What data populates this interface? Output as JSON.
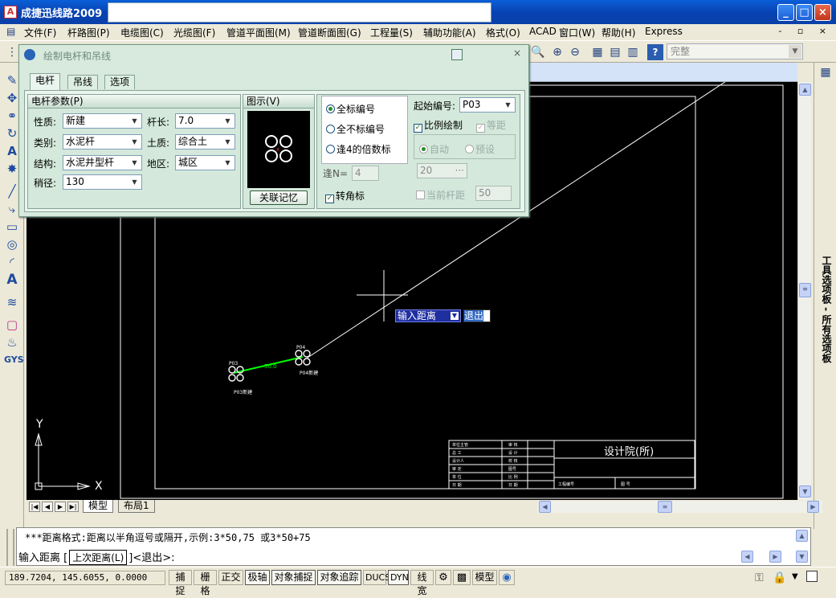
{
  "app": {
    "title": "成捷迅线路2009",
    "icon_letter": "A"
  },
  "menu": [
    "文件(F)",
    "杆路图(P)",
    "电缆图(C)",
    "光缆图(F)",
    "管道平面图(M)",
    "管道断面图(G)",
    "工程量(S)",
    "辅助功能(A)",
    "格式(O)",
    "ACAD",
    "窗口(W)",
    "帮助(H)",
    "Express"
  ],
  "toolbar": {
    "layer_value": "完整"
  },
  "dialog": {
    "title": "绘制电杆和吊线",
    "tabs": [
      "电杆",
      "吊线",
      "选项"
    ],
    "active_tab": "电杆",
    "params_panel": {
      "heading": "电杆参数(P)",
      "fields": {
        "nature_label": "性质:",
        "nature_value": "新建",
        "category_label": "类别:",
        "category_value": "水泥杆",
        "structure_label": "结构:",
        "structure_value": "水泥井型杆",
        "tip_diameter_label": "稍径:",
        "tip_diameter_value": "130",
        "pole_length_label": "杆长:",
        "pole_length_value": "7.0",
        "soil_label": "土质:",
        "soil_value": "综合土",
        "region_label": "地区:",
        "region_value": "城区"
      }
    },
    "preview_panel": {
      "heading": "图示(V)",
      "button": "关联记忆"
    },
    "numbering": {
      "radios": [
        "全标编号",
        "全不标编号",
        "逢4的倍数标"
      ],
      "selected": "全标编号",
      "every_n_label": "逢N=",
      "every_n_value": "4",
      "corner_label": "转角标",
      "corner_checked": true,
      "start_label": "起始编号:",
      "start_value": "P03",
      "scale_draw_label": "比例绘制",
      "scale_draw_checked": true,
      "equal_spacing_label": "等距",
      "equal_spacing_checked": true,
      "auto_label": "自动",
      "preset_label": "预设",
      "spacing_value": "20",
      "spacing_button": "···",
      "current_spacing_label": "当前杆距",
      "current_spacing_value": "50"
    }
  },
  "canvas": {
    "dyn_prompt": "输入距离",
    "dyn_exit": "退出",
    "titleblock_label": "设计院(所)",
    "axis_x": "X",
    "axis_y": "Y"
  },
  "layout_tabs": {
    "model": "模型",
    "layout1": "布局1"
  },
  "command": {
    "line1": "***距离格式:距离以半角逗号或隔开,示例:3*50,75 或3*50+75",
    "line2_prefix": "输入距离 [",
    "option": "上次距离(L)",
    "line2_suffix": "]<退出>:"
  },
  "palette": {
    "label": "工具选项板 - 所有选项板"
  },
  "status": {
    "coords": "189.7204, 145.6055, 0.0000",
    "toggles": [
      "捕捉",
      "栅格",
      "正交",
      "极轴",
      "对象捕捉",
      "对象追踪",
      "DUCS",
      "DYN",
      "线宽"
    ],
    "model_label": "模型"
  },
  "colors": {
    "title_bar": "#0a5fd8",
    "dialog_bg": "#d8eadd",
    "canvas_bg": "#000000",
    "span_line": "#00ff00"
  }
}
